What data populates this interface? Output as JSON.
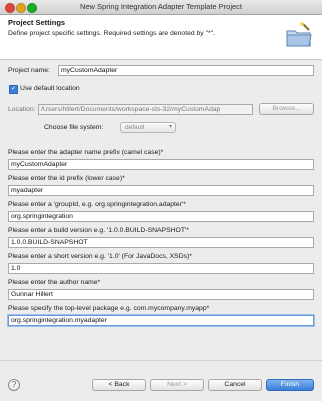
{
  "window": {
    "title": "New Spring Integration Adapter Template Project"
  },
  "banner": {
    "title": "Project Settings",
    "description": "Define project specific settings. Required settings are denoted by \"*\"."
  },
  "project": {
    "name_label": "Project name:",
    "name_value": "myCustomAdapter",
    "use_default_location_label": "Use default location",
    "location_label": "Location:",
    "location_value": "/Users/hillert/Documents/workspace-sts-32/myCustomAdap",
    "browse_label": "Browse...",
    "filesystem_label": "Choose file system:",
    "filesystem_value": "default"
  },
  "fields": [
    {
      "label": "Please enter the adapter name prefix (camel case)*",
      "value": "myCustomAdapter"
    },
    {
      "label": "Please enter the id prefix (lower case)*",
      "value": "myadapter"
    },
    {
      "label": "Please enter a 'groupId, e.g. org.springintegration.adapter'*",
      "value": "org.springintegration"
    },
    {
      "label": "Please enter a build version e.g. '1.0.0.BUILD-SNAPSHOT'*",
      "value": "1.0.0.BUILD-SNAPSHOT"
    },
    {
      "label": "Please enter a short version e.g. '1.0' (For JavaDocs, XSDs)*",
      "value": "1.0"
    },
    {
      "label": "Please enter the author name*",
      "value": "Gunnar Hillert"
    },
    {
      "label": "Please specify the top-level package e.g. com.mycompany.myapp*",
      "value": "org.springintegration.myadapter"
    }
  ],
  "footer": {
    "help_glyph": "?",
    "back_label": "< Back",
    "next_label": "Next >",
    "cancel_label": "Cancel",
    "finish_label": "Finish"
  }
}
